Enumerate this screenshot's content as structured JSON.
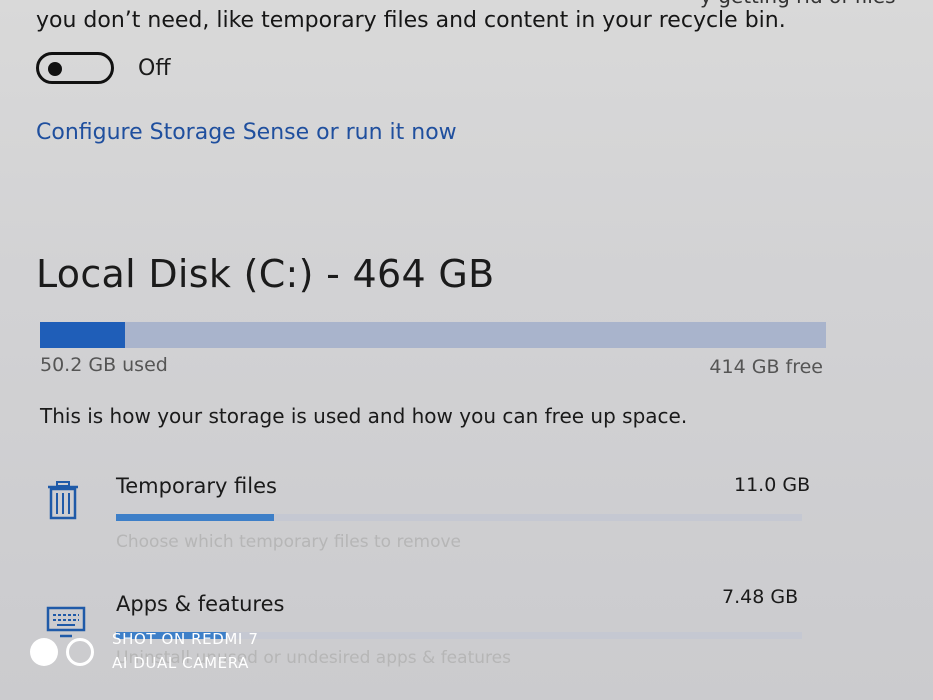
{
  "storage_sense": {
    "description_partial_top": "y getting rid of files",
    "description_line": "you don’t need, like temporary files and content in your recycle bin.",
    "toggle_label": "Off",
    "toggle_on": false,
    "configure_link": "Configure Storage Sense or run it now"
  },
  "disk": {
    "title": "Local Disk (C:) - 464 GB",
    "used_label": "50.2 GB used",
    "free_label": "414 GB free",
    "used_fraction": 0.108
  },
  "info_text": "This is how your storage is used and how you can free up space.",
  "categories": [
    {
      "name": "Temporary files",
      "size": "11.0 GB",
      "hint": "Choose which temporary files to remove",
      "icon": "trash-icon",
      "fill_fraction": 0.23
    },
    {
      "name": "Apps & features",
      "size": "7.48 GB",
      "hint": "Uninstall unused or undesired apps & features",
      "icon": "keyboard-icon",
      "fill_fraction": 0.16
    }
  ],
  "watermark": {
    "line1": "SHOT ON REDMI 7",
    "line2": "AI DUAL CAMERA"
  },
  "colors": {
    "accent": "#1f5eb8",
    "link": "#1f4f9e",
    "bar_track": "#a9b4cc"
  }
}
